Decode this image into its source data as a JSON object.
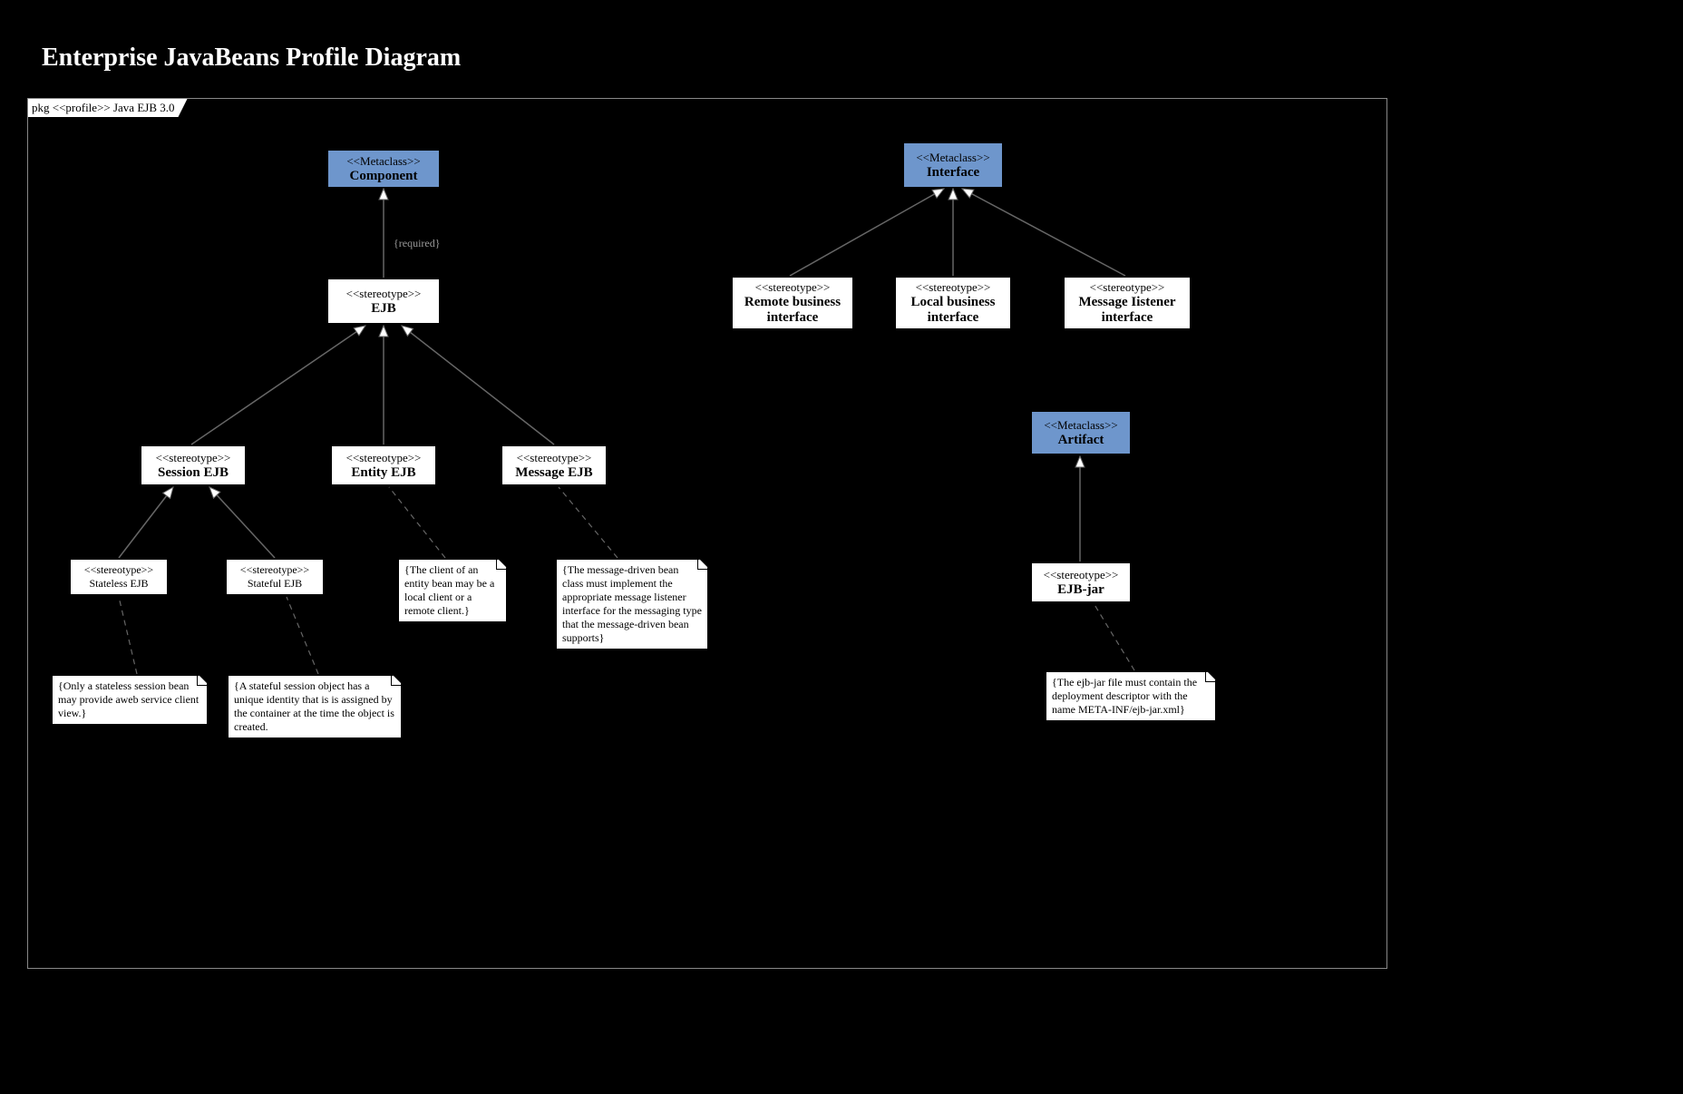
{
  "title": "Enterprise JavaBeans Profile Diagram",
  "frame_label": "pkg <<profile>> Java EJB 3.0",
  "required_label": "{required}",
  "nodes": {
    "component": {
      "stereo": "<<Metaclass>>",
      "name": "Component"
    },
    "ejb": {
      "stereo": "<<stereotype>>",
      "name": "EJB"
    },
    "session": {
      "stereo": "<<stereotype>>",
      "name": "Session EJB"
    },
    "entity": {
      "stereo": "<<stereotype>>",
      "name": "Entity EJB"
    },
    "message": {
      "stereo": "<<stereotype>>",
      "name": "Message EJB"
    },
    "stateless": {
      "stereo": "<<stereotype>>",
      "name": "Stateless EJB"
    },
    "stateful": {
      "stereo": "<<stereotype>>",
      "name": "Stateful EJB"
    },
    "interface": {
      "stereo": "<<Metaclass>>",
      "name": "Interface"
    },
    "remote": {
      "stereo": "<<stereotype>>",
      "name": "Remote business interface"
    },
    "local": {
      "stereo": "<<stereotype>>",
      "name": "Local business interface"
    },
    "listener": {
      "stereo": "<<stereotype>>",
      "name": "Message Iistener interface"
    },
    "artifact": {
      "stereo": "<<Metaclass>>",
      "name": "Artifact"
    },
    "ejbjar": {
      "stereo": "<<stereotype>>",
      "name": "EJB-jar"
    }
  },
  "notes": {
    "stateless_note": "{Only a stateless session bean may provide aweb service client view.}",
    "stateful_note": "{A stateful session object has a unique identity that is is assigned by the container at the time the object is created.",
    "entity_note": "{The client of an entity bean may be a local client or a remote client.}",
    "message_note": "{The message-driven bean class must implement the appropriate message listener interface for the messaging type that the message-driven bean supports}",
    "ejbjar_note": "{The ejb-jar file must contain the deployment descriptor with the name META-INF/ejb-jar.xml}"
  }
}
